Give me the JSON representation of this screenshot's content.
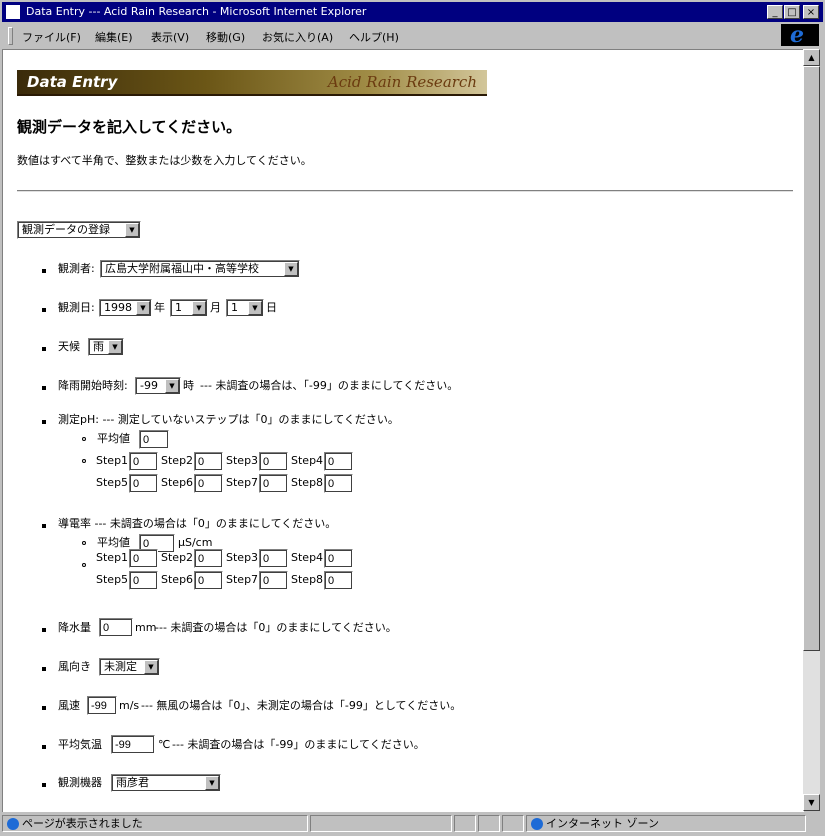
{
  "window": {
    "title": "Data Entry --- Acid Rain Research - Microsoft Internet Explorer",
    "buttons": {
      "minimize": "_",
      "maximize": "□",
      "close": "×"
    }
  },
  "menu": [
    "ファイル(F)",
    "編集(E)",
    "表示(V)",
    "移動(G)",
    "お気に入り(A)",
    "ヘルプ(H)"
  ],
  "ie_logo": "e",
  "banner": {
    "left": "Data Entry",
    "right": "Acid Rain Research"
  },
  "heading": "観測データを記入してください。",
  "instruction": "数値はすべて半角で、整数または少数を入力してください。",
  "mode_select": "観測データの登録",
  "fields": {
    "observer": {
      "label": "観測者:",
      "value": "広島大学附属福山中・高等学校"
    },
    "date": {
      "label": "観測日:",
      "year": "1998",
      "year_unit": "年",
      "month": "1",
      "month_unit": "月",
      "day": "1",
      "day_unit": "日"
    },
    "weather": {
      "label": "天候",
      "value": "雨"
    },
    "rain_start": {
      "label": "降雨開始時刻:",
      "value": "-99",
      "unit": "時",
      "note": "--- 未調査の場合は、「-99」のままにしてください。"
    },
    "ph": {
      "label": "測定pH: --- 測定していないステップは「0」のままにしてください。",
      "avg_label": "平均値",
      "avg_value": "0",
      "steps": [
        {
          "label": "Step1:",
          "value": "0"
        },
        {
          "label": "Step2:",
          "value": "0"
        },
        {
          "label": "Step3:",
          "value": "0"
        },
        {
          "label": "Step4:",
          "value": "0"
        },
        {
          "label": "Step5:",
          "value": "0"
        },
        {
          "label": "Step6:",
          "value": "0"
        },
        {
          "label": "Step7:",
          "value": "0"
        },
        {
          "label": "Step8:",
          "value": "0"
        }
      ]
    },
    "conductivity": {
      "label": "導電率 --- 未調査の場合は「0」のままにしてください。",
      "avg_label": "平均値",
      "avg_value": "0",
      "avg_unit": "μS/cm",
      "steps": [
        {
          "label": "Step1:",
          "value": "0"
        },
        {
          "label": "Step2:",
          "value": "0"
        },
        {
          "label": "Step3:",
          "value": "0"
        },
        {
          "label": "Step4:",
          "value": "0"
        },
        {
          "label": "Step5:",
          "value": "0"
        },
        {
          "label": "Step6:",
          "value": "0"
        },
        {
          "label": "Step7:",
          "value": "0"
        },
        {
          "label": "Step8:",
          "value": "0"
        }
      ]
    },
    "precipitation": {
      "label": "降水量",
      "value": "0",
      "unit": "mm",
      "note": "--- 未調査の場合は「0」のままにしてください。"
    },
    "wind_dir": {
      "label": "風向き",
      "value": "未測定"
    },
    "wind_speed": {
      "label": "風速",
      "value": "-99",
      "unit": "m/s",
      "note": "--- 無風の場合は「0」、未測定の場合は「-99」としてください。"
    },
    "temperature": {
      "label": "平均気温",
      "value": "-99",
      "unit": "℃",
      "note": "--- 未調査の場合は「-99」のままにしてください。"
    },
    "instrument": {
      "label": "観測機器",
      "value": "雨彦君"
    }
  },
  "status": {
    "text": "ページが表示されました",
    "zone": "インターネット ゾーン"
  }
}
